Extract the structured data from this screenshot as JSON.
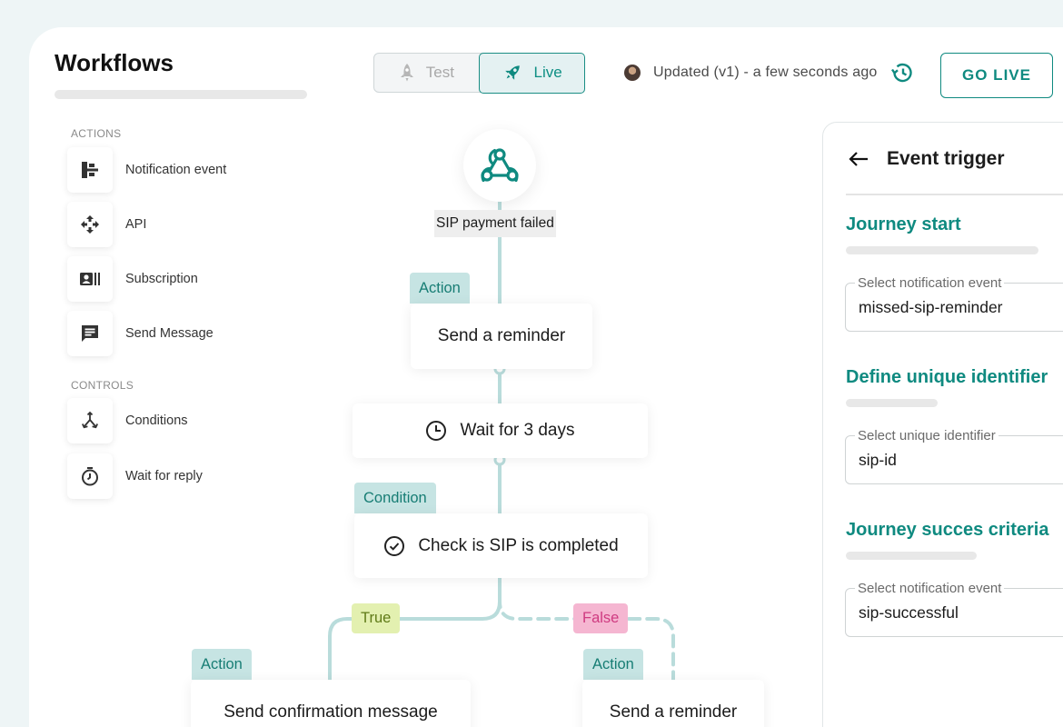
{
  "header": {
    "title": "Workflows",
    "toggle": {
      "test": "Test",
      "live": "Live",
      "selected": "live"
    },
    "status": "Updated (v1) - a few seconds ago",
    "go_live": "GO LIVE"
  },
  "sidebar": {
    "actions_label": "ACTIONS",
    "actions": [
      {
        "label": "Notification event",
        "icon": "hierarchy-icon"
      },
      {
        "label": "API",
        "icon": "api-arrows-icon"
      },
      {
        "label": "Subscription",
        "icon": "contact-card-icon"
      },
      {
        "label": "Send Message",
        "icon": "message-icon"
      }
    ],
    "controls_label": "CONTROLS",
    "controls": [
      {
        "label": "Conditions",
        "icon": "split-arrows-icon"
      },
      {
        "label": "Wait for reply",
        "icon": "timer-icon"
      }
    ]
  },
  "flow": {
    "trigger": "SIP payment failed",
    "step1": {
      "tag": "Action",
      "label": "Send a reminder"
    },
    "wait": {
      "label": "Wait for 3 days"
    },
    "condition": {
      "tag": "Condition",
      "label": "Check is SIP is completed"
    },
    "true_label": "True",
    "false_label": "False",
    "true_branch": {
      "tag": "Action",
      "label": "Send confirmation message"
    },
    "false_branch": {
      "tag": "Action",
      "label": "Send a reminder"
    }
  },
  "panel": {
    "title": "Event trigger",
    "sections": [
      {
        "heading": "Journey start",
        "field_label": "Select notification event",
        "value": "missed-sip-reminder"
      },
      {
        "heading": "Define unique identifier",
        "field_label": "Select unique identifier",
        "value": "sip-id"
      },
      {
        "heading": "Journey succes criteria",
        "field_label": "Select notification event",
        "value": "sip-successful"
      }
    ]
  },
  "colors": {
    "accent": "#0f8a80",
    "connector": "#b9dcdb",
    "true_bg": "#e3f0b0",
    "false_bg": "#f5b6d1"
  }
}
